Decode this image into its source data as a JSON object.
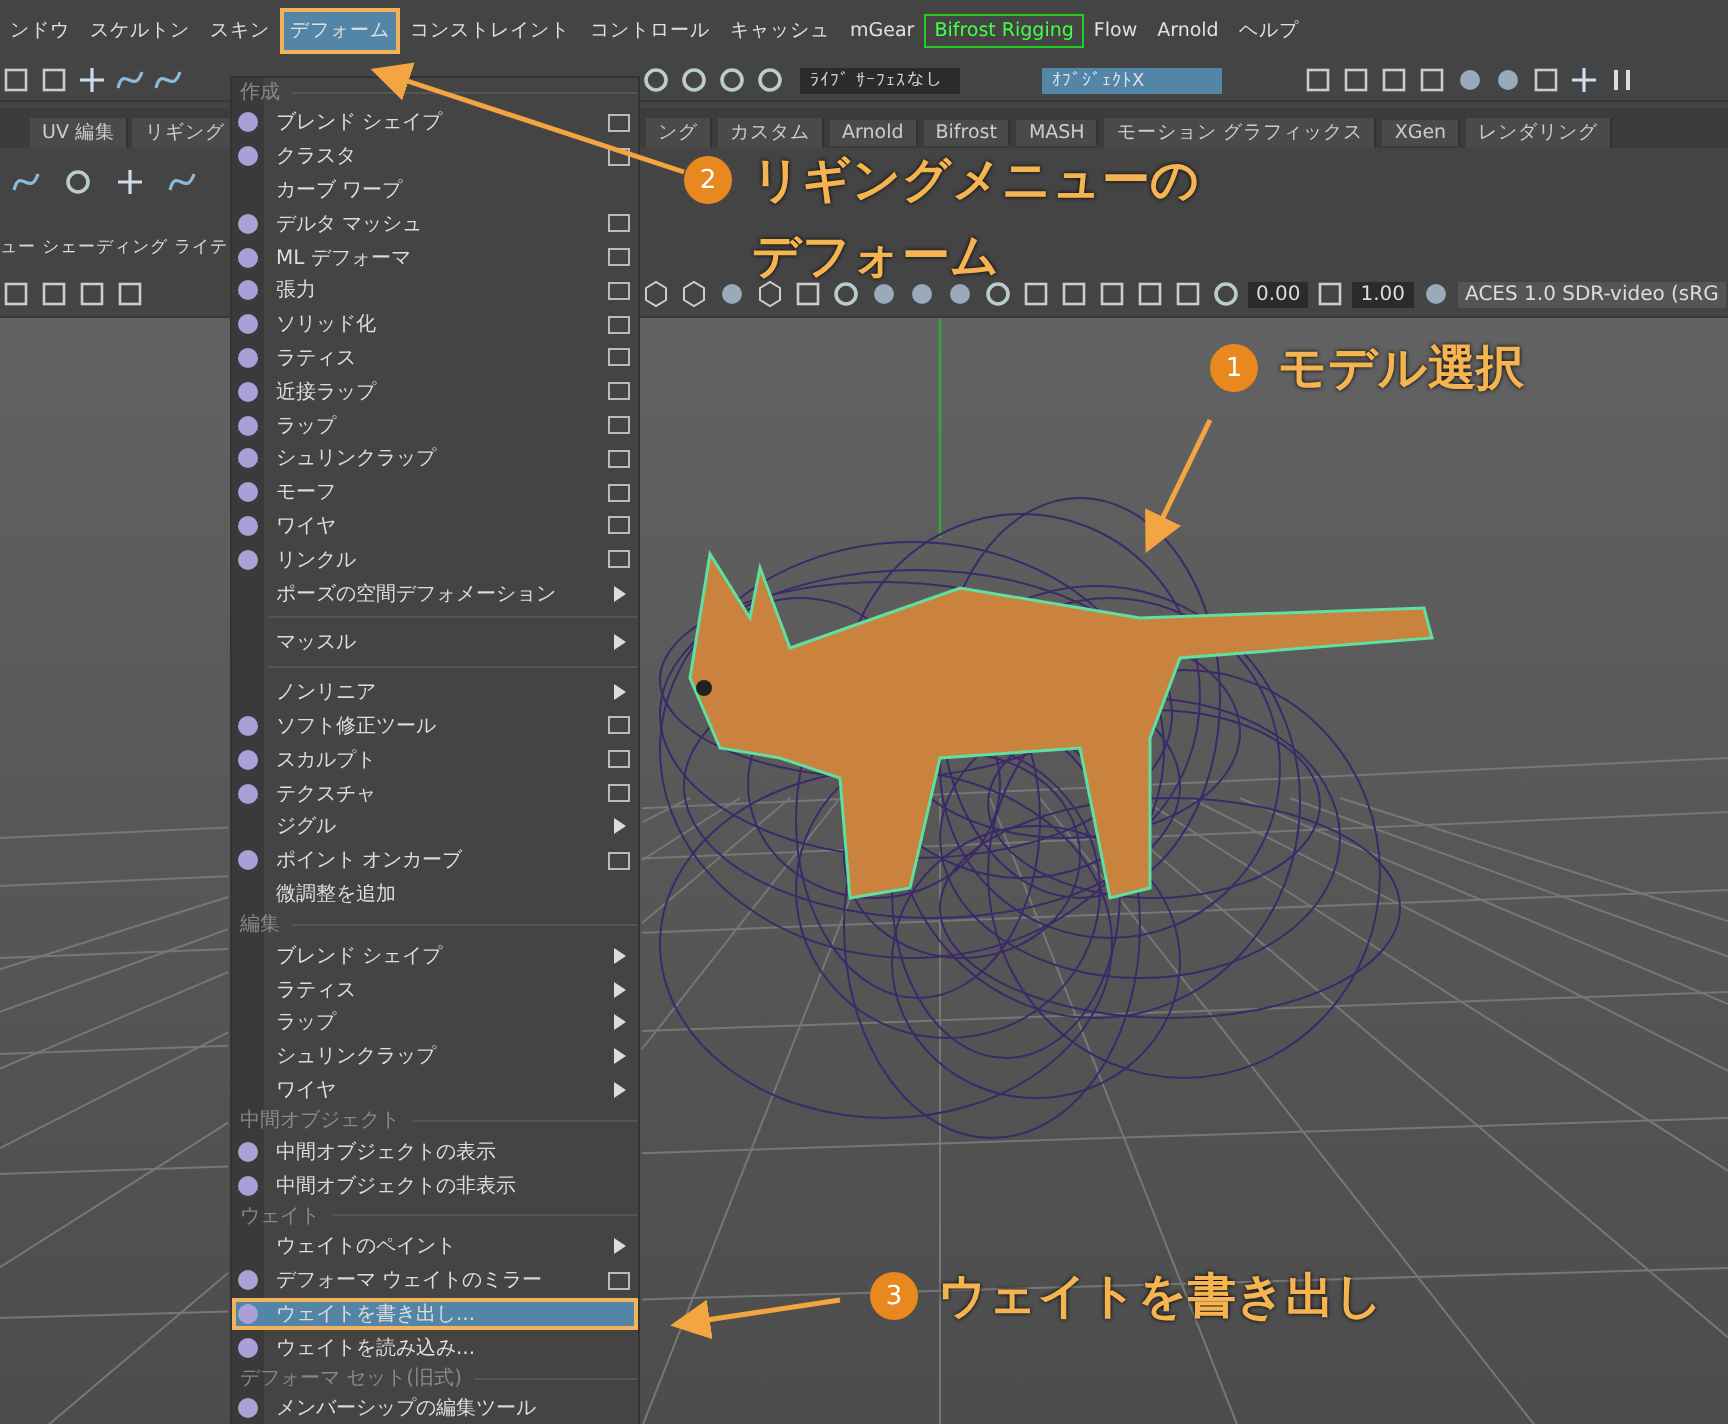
{
  "menubar": {
    "items": [
      {
        "label": "ンドウ",
        "kind": "plain",
        "selected": false
      },
      {
        "label": "スケルトン",
        "kind": "plain",
        "selected": false
      },
      {
        "label": "スキン",
        "kind": "plain",
        "selected": false
      },
      {
        "label": "デフォーム",
        "kind": "plain",
        "selected": true
      },
      {
        "label": "コンストレイント",
        "kind": "plain",
        "selected": false
      },
      {
        "label": "コントロール",
        "kind": "plain",
        "selected": false
      },
      {
        "label": "キャッシュ",
        "kind": "plain",
        "selected": false
      },
      {
        "label": "mGear",
        "kind": "plain",
        "selected": false
      },
      {
        "label": "Bifrost Rigging",
        "kind": "boxed",
        "selected": false
      },
      {
        "label": "Flow",
        "kind": "plain",
        "selected": false
      },
      {
        "label": "Arnold",
        "kind": "plain",
        "selected": false
      },
      {
        "label": "ヘルプ",
        "kind": "plain",
        "selected": false
      }
    ]
  },
  "toolbar": {
    "live_surface": "ﾗｲﾌﾞ ｻｰﾌｪｽなし",
    "object_mode": "ｵﾌﾞｼﾞｪｸﾄX"
  },
  "shelf_tabs": {
    "left": [
      "UV 編集",
      "リギング"
    ],
    "right": [
      "ング",
      "カスタム",
      "Arnold",
      "Bifrost",
      "MASH",
      "モーション グラフィックス",
      "XGen",
      "レンダリング"
    ]
  },
  "panel_menu": [
    "ュー",
    "シェーディング",
    "ライテ"
  ],
  "viewport_toolbar": {
    "exposure": "0.00",
    "gamma": "1.00",
    "color_space": "ACES 1.0 SDR-video (sRG"
  },
  "deform_menu": {
    "items": [
      {
        "kind": "header",
        "label": "作成"
      },
      {
        "kind": "item",
        "label": "ブレンド シェイプ",
        "icon": true,
        "option_box": true,
        "submenu": false,
        "selected": false
      },
      {
        "kind": "item",
        "label": "クラスタ",
        "icon": true,
        "option_box": true,
        "submenu": false,
        "selected": false
      },
      {
        "kind": "item",
        "label": "カーブ ワープ",
        "icon": false,
        "option_box": false,
        "submenu": false,
        "selected": false
      },
      {
        "kind": "item",
        "label": "デルタ マッシュ",
        "icon": true,
        "option_box": true,
        "submenu": false,
        "selected": false
      },
      {
        "kind": "item",
        "label": "ML デフォーマ",
        "icon": true,
        "option_box": true,
        "submenu": false,
        "selected": false
      },
      {
        "kind": "item",
        "label": "張力",
        "icon": true,
        "option_box": true,
        "submenu": false,
        "selected": false
      },
      {
        "kind": "item",
        "label": "ソリッド化",
        "icon": true,
        "option_box": true,
        "submenu": false,
        "selected": false
      },
      {
        "kind": "item",
        "label": "ラティス",
        "icon": true,
        "option_box": true,
        "submenu": false,
        "selected": false
      },
      {
        "kind": "item",
        "label": "近接ラップ",
        "icon": true,
        "option_box": true,
        "submenu": false,
        "selected": false
      },
      {
        "kind": "item",
        "label": "ラップ",
        "icon": true,
        "option_box": true,
        "submenu": false,
        "selected": false
      },
      {
        "kind": "item",
        "label": "シュリンクラップ",
        "icon": true,
        "option_box": true,
        "submenu": false,
        "selected": false
      },
      {
        "kind": "item",
        "label": "モーフ",
        "icon": true,
        "option_box": true,
        "submenu": false,
        "selected": false
      },
      {
        "kind": "item",
        "label": "ワイヤ",
        "icon": true,
        "option_box": true,
        "submenu": false,
        "selected": false
      },
      {
        "kind": "item",
        "label": "リンクル",
        "icon": true,
        "option_box": true,
        "submenu": false,
        "selected": false
      },
      {
        "kind": "item",
        "label": "ポーズの空間デフォメーション",
        "icon": false,
        "option_box": false,
        "submenu": true,
        "selected": false
      },
      {
        "kind": "separator"
      },
      {
        "kind": "item",
        "label": "マッスル",
        "icon": false,
        "option_box": false,
        "submenu": true,
        "selected": false
      },
      {
        "kind": "separator"
      },
      {
        "kind": "item",
        "label": "ノンリニア",
        "icon": false,
        "option_box": false,
        "submenu": true,
        "selected": false
      },
      {
        "kind": "item",
        "label": "ソフト修正ツール",
        "icon": true,
        "option_box": true,
        "submenu": false,
        "selected": false
      },
      {
        "kind": "item",
        "label": "スカルプト",
        "icon": true,
        "option_box": true,
        "submenu": false,
        "selected": false
      },
      {
        "kind": "item",
        "label": "テクスチャ",
        "icon": true,
        "option_box": true,
        "submenu": false,
        "selected": false
      },
      {
        "kind": "item",
        "label": "ジグル",
        "icon": false,
        "option_box": false,
        "submenu": true,
        "selected": false
      },
      {
        "kind": "item",
        "label": "ポイント オンカーブ",
        "icon": true,
        "option_box": true,
        "submenu": false,
        "selected": false
      },
      {
        "kind": "item",
        "label": "微調整を追加",
        "icon": false,
        "option_box": false,
        "submenu": false,
        "selected": false
      },
      {
        "kind": "header",
        "label": "編集"
      },
      {
        "kind": "item",
        "label": "ブレンド シェイプ",
        "icon": false,
        "option_box": false,
        "submenu": true,
        "selected": false
      },
      {
        "kind": "item",
        "label": "ラティス",
        "icon": false,
        "option_box": false,
        "submenu": true,
        "selected": false
      },
      {
        "kind": "item",
        "label": "ラップ",
        "icon": false,
        "option_box": false,
        "submenu": true,
        "selected": false
      },
      {
        "kind": "item",
        "label": "シュリンクラップ",
        "icon": false,
        "option_box": false,
        "submenu": true,
        "selected": false
      },
      {
        "kind": "item",
        "label": "ワイヤ",
        "icon": false,
        "option_box": false,
        "submenu": true,
        "selected": false
      },
      {
        "kind": "header",
        "label": "中間オブジェクト"
      },
      {
        "kind": "item",
        "label": "中間オブジェクトの表示",
        "icon": true,
        "option_box": false,
        "submenu": false,
        "selected": false
      },
      {
        "kind": "item",
        "label": "中間オブジェクトの非表示",
        "icon": true,
        "option_box": false,
        "submenu": false,
        "selected": false
      },
      {
        "kind": "header",
        "label": "ウェイト"
      },
      {
        "kind": "item",
        "label": "ウェイトのペイント",
        "icon": false,
        "option_box": false,
        "submenu": true,
        "selected": false
      },
      {
        "kind": "item",
        "label": "デフォーマ ウェイトのミラー",
        "icon": true,
        "option_box": true,
        "submenu": false,
        "selected": false
      },
      {
        "kind": "item",
        "label": "ウェイトを書き出し...",
        "icon": true,
        "option_box": false,
        "submenu": false,
        "selected": true
      },
      {
        "kind": "item",
        "label": "ウェイトを読み込み...",
        "icon": true,
        "option_box": false,
        "submenu": false,
        "selected": false
      },
      {
        "kind": "header",
        "label": "デフォーマ セット(旧式)"
      },
      {
        "kind": "item",
        "label": "メンバーシップの編集ツール",
        "icon": true,
        "option_box": false,
        "submenu": false,
        "selected": false
      }
    ]
  },
  "annotations": [
    {
      "number": "2",
      "lines": [
        "リギングメニューの",
        "デフォーム"
      ]
    },
    {
      "number": "1",
      "lines": [
        "モデル選択"
      ]
    },
    {
      "number": "3",
      "lines": [
        "ウェイトを書き出し"
      ]
    }
  ]
}
